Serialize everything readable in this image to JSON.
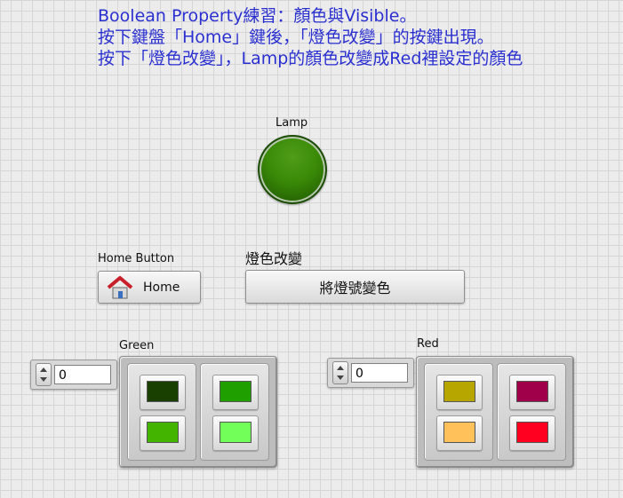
{
  "description": {
    "line1": "Boolean Property練習：顏色與Visible。",
    "line2": "按下鍵盤「Home」鍵後，「燈色改變」的按鍵出現。",
    "line3": "按下「燈色改變」，Lamp的顏色改變成Red裡設定的顏色"
  },
  "lamp": {
    "label": "Lamp",
    "color": "#2f7a06"
  },
  "home_button": {
    "label": "Home Button",
    "text": "Home",
    "icon": "home-icon"
  },
  "change_button": {
    "label": "燈色改變",
    "text": "將燈號變色"
  },
  "green": {
    "label": "Green",
    "value": "0",
    "swatches": [
      "#1a4000",
      "#1fa000",
      "#43b400",
      "#72ff5a"
    ]
  },
  "red": {
    "label": "Red",
    "value": "0",
    "swatches": [
      "#b7a500",
      "#a0004a",
      "#ffc25a",
      "#ff0020"
    ]
  }
}
